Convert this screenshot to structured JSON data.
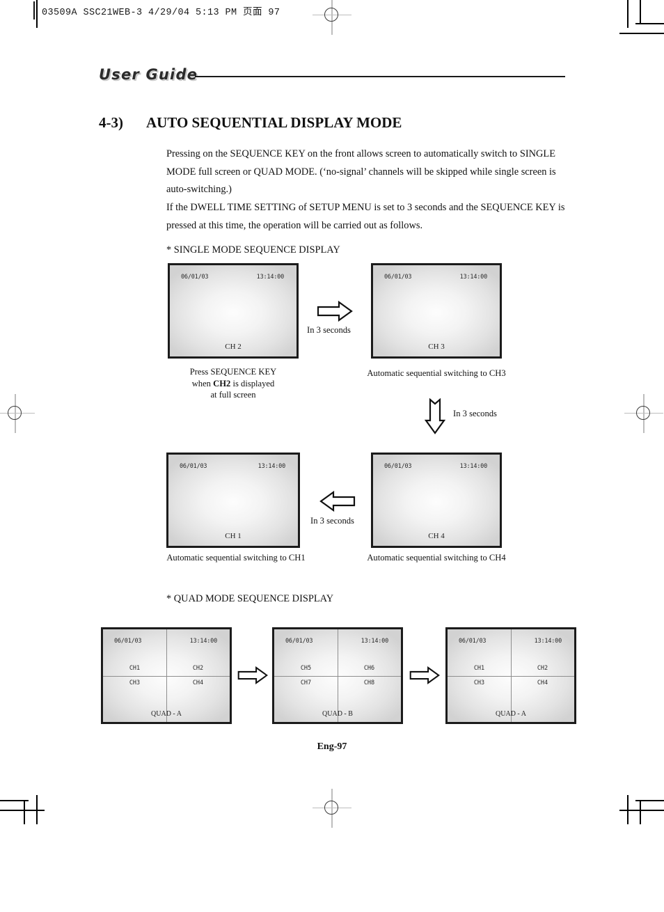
{
  "scan_header": "03509A SSC21WEB-3  4/29/04  5:13 PM  页面 97",
  "banner": {
    "title": "User Guide"
  },
  "heading": {
    "number": "4-3)",
    "title": "AUTO SEQUENTIAL DISPLAY MODE"
  },
  "body": {
    "paragraph1": "Pressing on the SEQUENCE KEY on the front allows screen to automatically switch to SINGLE MODE full screen or QUAD MODE. (‘no-signal’ channels will be skipped while single screen is auto-switching.)",
    "paragraph2": "If the DWELL TIME SETTING of SETUP MENU is set to 3 seconds and the SEQUENCE KEY is pressed at this time, the operation will be carried out as follows."
  },
  "sections": {
    "single_mode_label": "* SINGLE MODE SEQUENCE DISPLAY",
    "quad_mode_label": "* QUAD MODE SEQUENCE DISPLAY"
  },
  "single_screens": [
    {
      "date": "06/01/03",
      "time": "13:14:00",
      "channel": "CH 2"
    },
    {
      "date": "06/01/03",
      "time": "13:14:00",
      "channel": "CH 3"
    },
    {
      "date": "06/01/03",
      "time": "13:14:00",
      "channel": "CH 1"
    },
    {
      "date": "06/01/03",
      "time": "13:14:00",
      "channel": "CH 4"
    }
  ],
  "single_captions": {
    "ch2_line1": "Press SEQUENCE KEY",
    "ch2_line2_pre": "when ",
    "ch2_line2_bold": "CH2",
    "ch2_line2_post": " is displayed",
    "ch2_line3": "at full screen",
    "ch3": "Automatic sequential switching to CH3",
    "ch1": "Automatic sequential switching to CH1",
    "ch4": "Automatic sequential switching to CH4"
  },
  "arrows": {
    "right_top_label": "In 3 seconds",
    "down_label": "In 3 seconds",
    "left_bottom_label": "In 3 seconds"
  },
  "quad_screens": [
    {
      "date": "06/01/03",
      "time": "13:14:00",
      "cells": {
        "top_left": "CH1",
        "top_right": "CH2",
        "bottom_left": "CH3",
        "bottom_right": "CH4"
      },
      "label": "QUAD - A"
    },
    {
      "date": "06/01/03",
      "time": "13:14:00",
      "cells": {
        "top_left": "CH5",
        "top_right": "CH6",
        "bottom_left": "CH7",
        "bottom_right": "CH8"
      },
      "label": "QUAD - B"
    },
    {
      "date": "06/01/03",
      "time": "13:14:00",
      "cells": {
        "top_left": "CH1",
        "top_right": "CH2",
        "bottom_left": "CH3",
        "bottom_right": "CH4"
      },
      "label": "QUAD - A"
    }
  ],
  "footer": {
    "page": "Eng-97"
  },
  "colors": {
    "ink": "#111111",
    "screen_border": "#1b1b1b",
    "banner_shadow": "#c9c9c9"
  }
}
